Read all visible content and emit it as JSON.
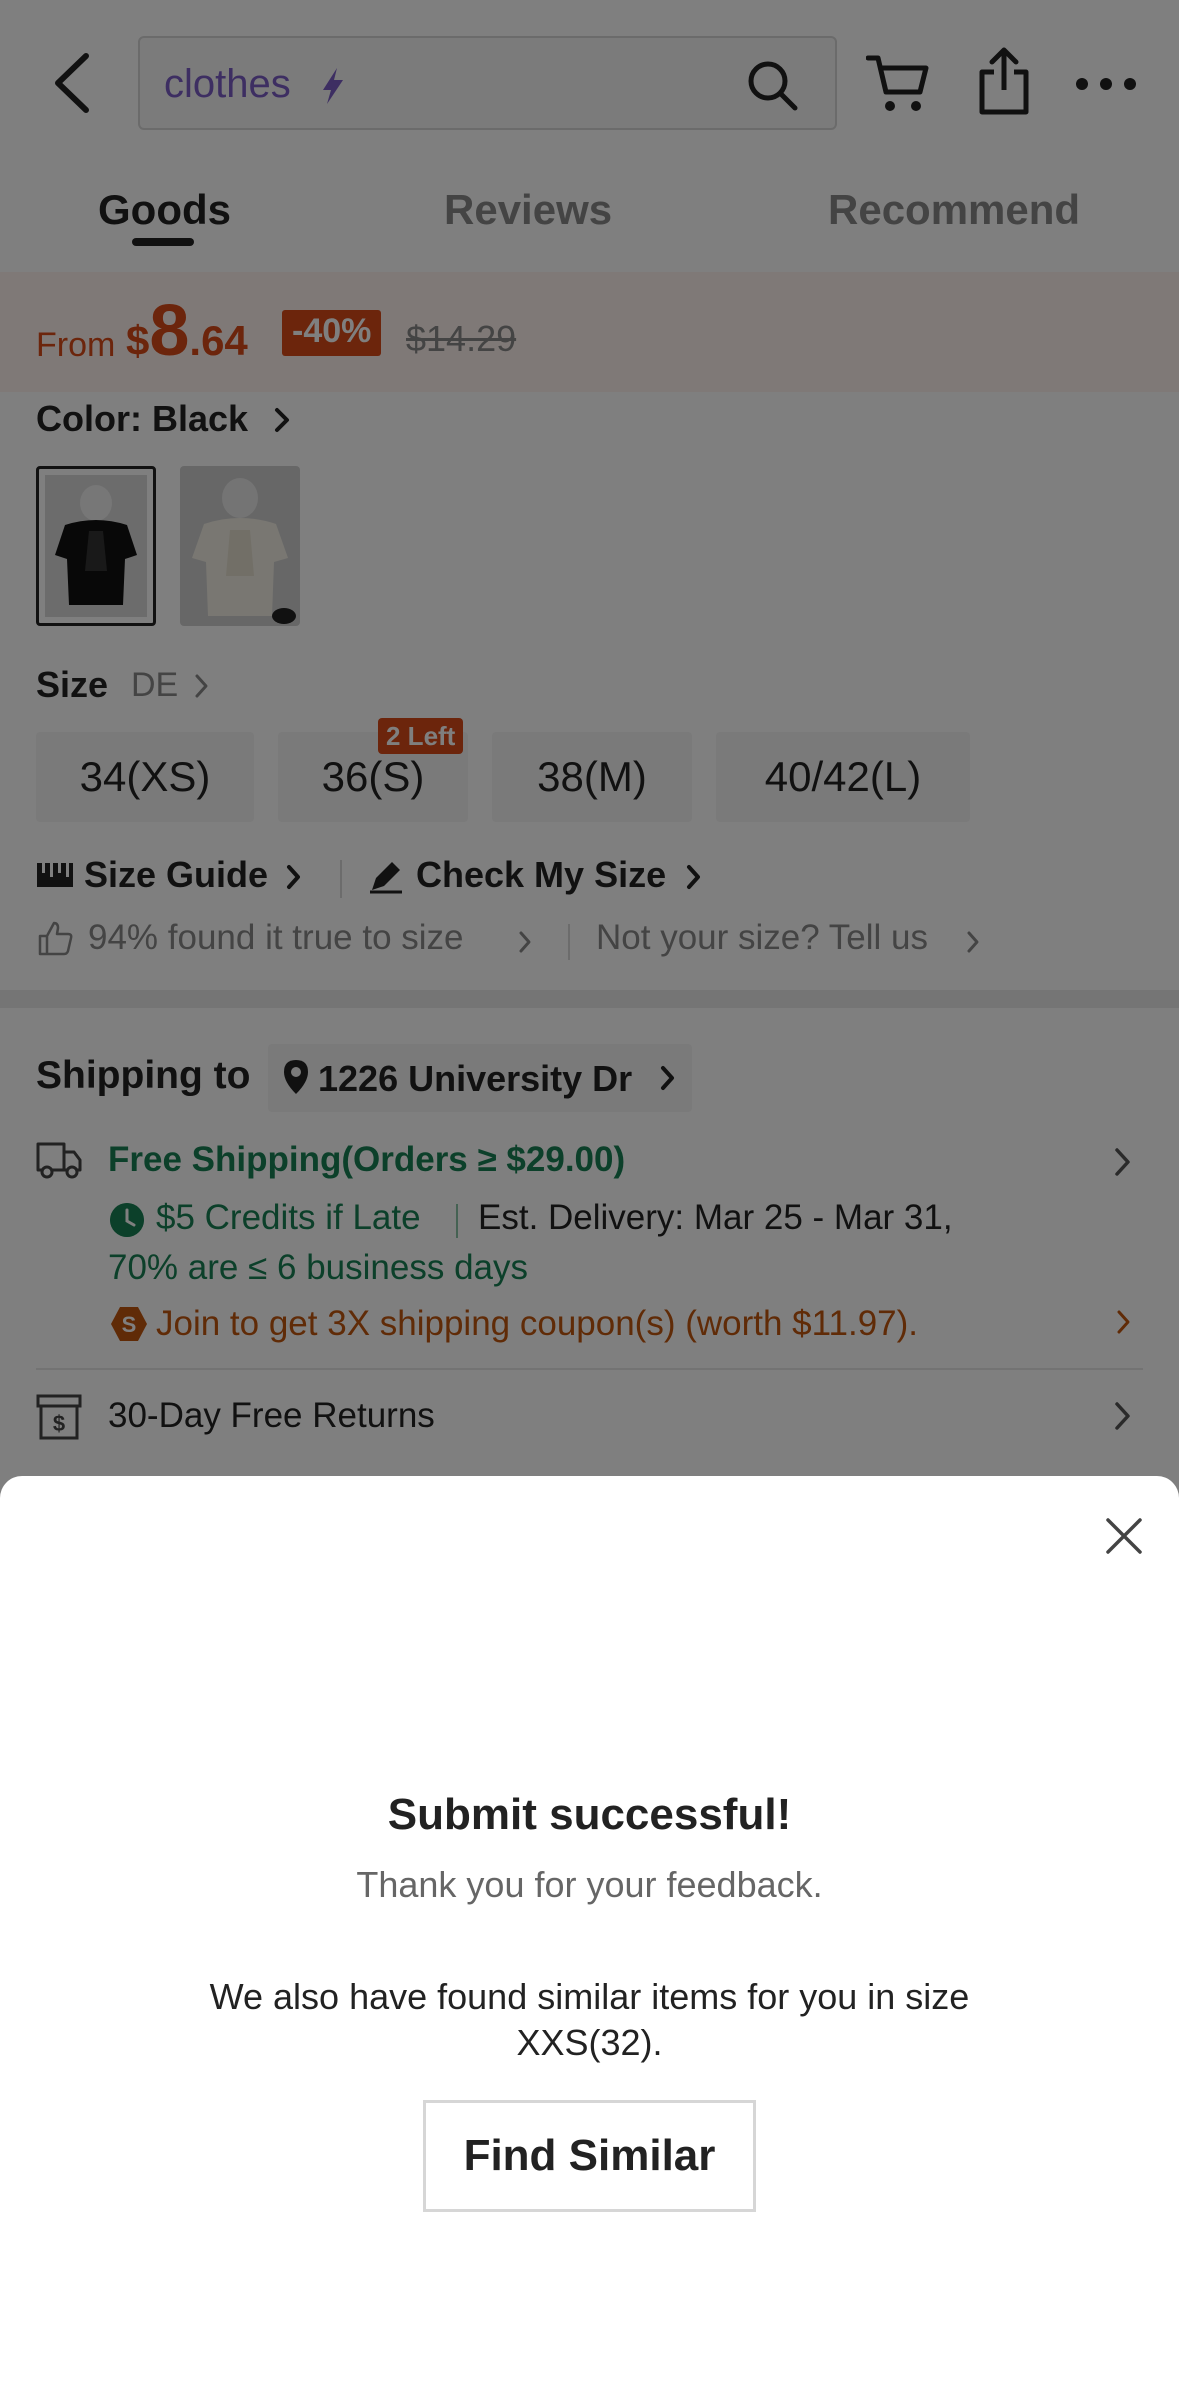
{
  "header": {
    "search_value": "clothes",
    "tabs": [
      "Goods",
      "Reviews",
      "Recommend"
    ],
    "active_tab": "Goods"
  },
  "price": {
    "from_label": "From",
    "currency": "$",
    "integer": "8",
    "decimal": ".64",
    "discount": "-40%",
    "original": "$14.29",
    "accent_color": "#d94a18"
  },
  "color": {
    "label": "Color: Black",
    "swatches": [
      "black",
      "cream"
    ]
  },
  "size": {
    "label": "Size",
    "unit": "DE",
    "options": [
      "34(XS)",
      "36(S)",
      "38(M)",
      "40/42(L)"
    ],
    "stock_badge": "2 Left",
    "guide": "Size Guide",
    "check": "Check My Size",
    "fit": "94% found it true to size",
    "not_your_size": "Not your size? Tell us"
  },
  "shipping": {
    "title": "Shipping to",
    "address": "1226 University Dr",
    "free_shipping": "Free Shipping(Orders ≥ $29.00)",
    "credits": "$5 Credits if Late",
    "est_delivery": "Est. Delivery: Mar 25 - Mar 31,",
    "pct": "70% are ≤ 6 business days",
    "coupon": "Join to get 3X shipping coupon(s) (worth $11.97).",
    "returns": "30-Day Free Returns",
    "green_color": "#198055",
    "orange_color": "#c0560f"
  },
  "sheet": {
    "title": "Submit successful!",
    "subtitle": "Thank you for your feedback.",
    "message": "We also have found similar items for you in size XXS(32).",
    "button": "Find Similar"
  }
}
